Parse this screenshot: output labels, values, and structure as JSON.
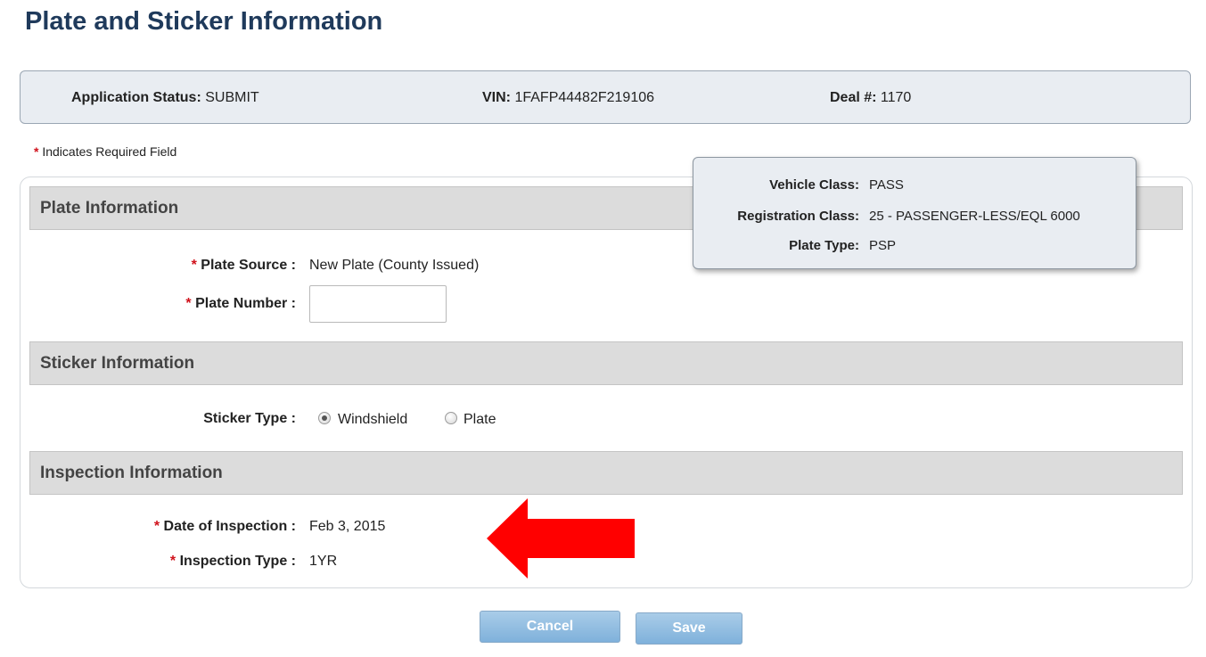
{
  "page": {
    "title": "Plate and Sticker Information"
  },
  "status": {
    "app_status_label": "Application Status:",
    "app_status_value": "SUBMIT",
    "vin_label": "VIN:",
    "vin_value": "1FAFP44482F219106",
    "deal_label": "Deal #:",
    "deal_value": "1170"
  },
  "required_note": {
    "star": "*",
    "text": "Indicates Required Field"
  },
  "vehicle_popup": {
    "vehicle_class_label": "Vehicle Class:",
    "vehicle_class_value": "PASS",
    "registration_class_label": "Registration Class:",
    "registration_class_value": "25 - PASSENGER-LESS/EQL 6000",
    "plate_type_label": "Plate Type:",
    "plate_type_value": "PSP"
  },
  "plate_info": {
    "header": "Plate Information",
    "plate_source_label": "Plate Source :",
    "plate_source_value": "New Plate (County Issued)",
    "plate_number_label": "Plate Number :",
    "plate_number_value": ""
  },
  "sticker_info": {
    "header": "Sticker Information",
    "sticker_type_label": "Sticker Type :",
    "options": [
      "Windshield",
      "Plate"
    ],
    "selected": "Windshield"
  },
  "inspection_info": {
    "header": "Inspection Information",
    "date_label": "Date of Inspection :",
    "date_value": "Feb 3, 2015",
    "type_label": "Inspection Type :",
    "type_value": "1YR"
  },
  "buttons": {
    "cancel": "Cancel",
    "save": "Save"
  },
  "colors": {
    "title": "#1f3a5b",
    "required_star": "#d0111b",
    "annotation_arrow": "#ff0000",
    "button": "#8dbbe0"
  },
  "icons": {
    "annotation": "red-arrow-left-icon",
    "required": "asterisk-icon"
  }
}
